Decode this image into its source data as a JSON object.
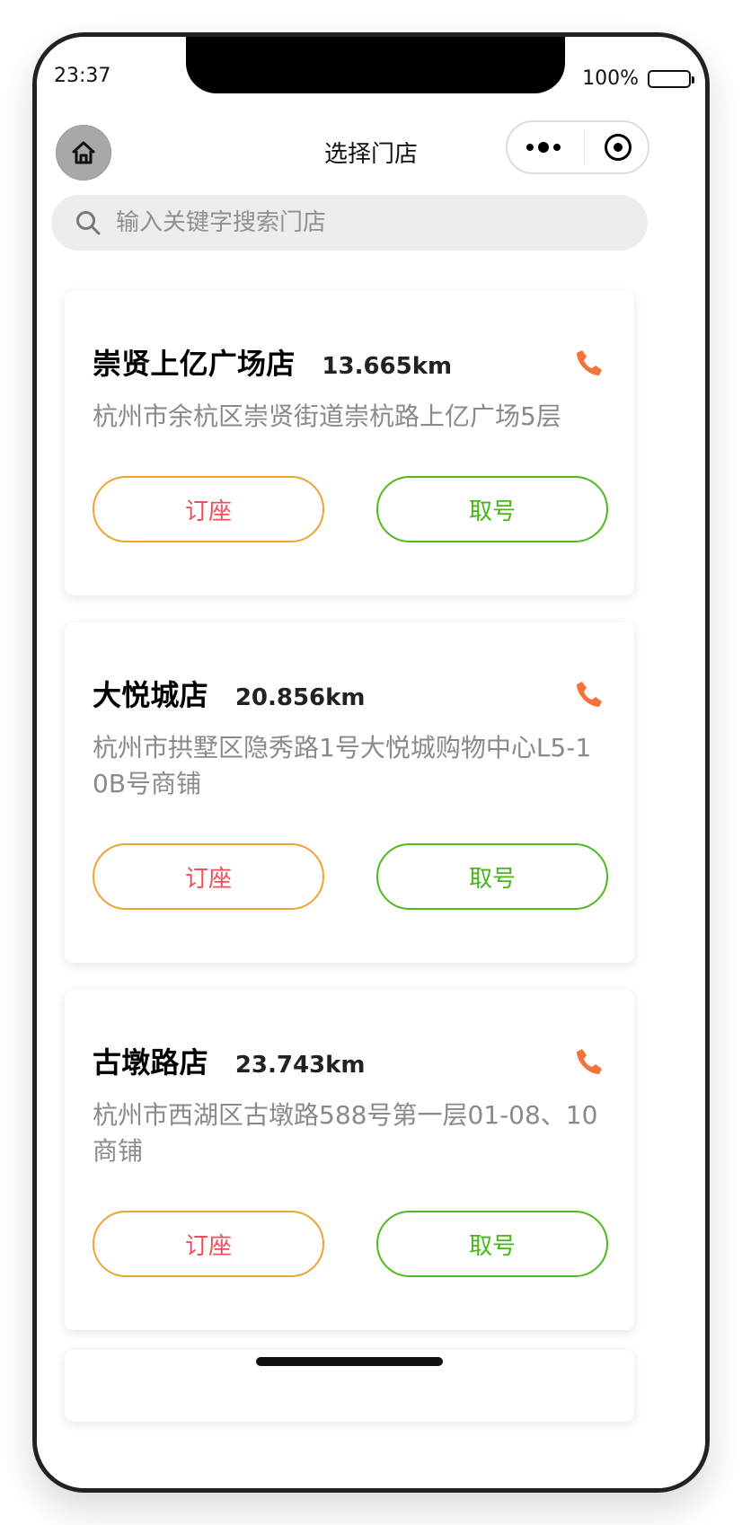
{
  "status_bar": {
    "time": "23:37",
    "battery_text": "100%",
    "battery_level": 1.0
  },
  "nav": {
    "title": "选择门店",
    "home_icon": "home-icon",
    "more_icon": "more-dots-icon",
    "close_icon": "target-close-icon"
  },
  "search": {
    "placeholder": "输入关键字搜索门店",
    "icon": "search-icon"
  },
  "colors": {
    "reserve_border": "#f0a235",
    "reserve_text": "#ee4f5a",
    "queue_border": "#4dbb1c",
    "queue_text": "#47b61a",
    "phone_icon": "#f3733b"
  },
  "stores": [
    {
      "name": "崇贤上亿广场店",
      "distance": "13.665km",
      "address": "杭州市余杭区崇贤街道崇杭路上亿广场5层",
      "reserve_label": "订座",
      "queue_label": "取号",
      "phone_icon": "phone-icon"
    },
    {
      "name": "大悦城店",
      "distance": "20.856km",
      "address": "杭州市拱墅区隐秀路1号大悦城购物中心L5-10B号商铺",
      "reserve_label": "订座",
      "queue_label": "取号",
      "phone_icon": "phone-icon"
    },
    {
      "name": "古墩路店",
      "distance": "23.743km",
      "address": "杭州市西湖区古墩路588号第一层01-08、10商铺",
      "reserve_label": "订座",
      "queue_label": "取号",
      "phone_icon": "phone-icon"
    }
  ]
}
